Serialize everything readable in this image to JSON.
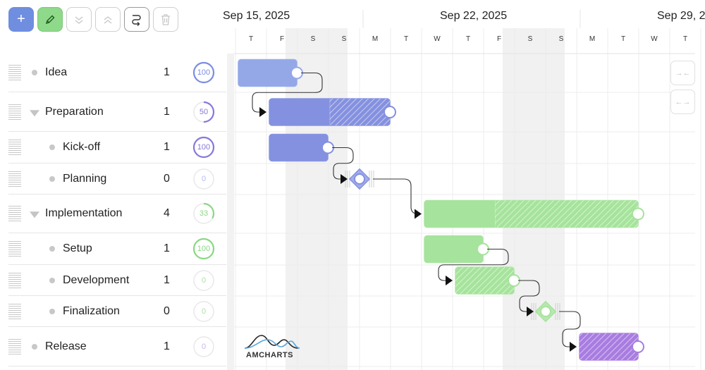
{
  "toolbar": {
    "buttons": [
      {
        "name": "add",
        "icon": "plus-icon",
        "label": "+"
      },
      {
        "name": "edit",
        "icon": "pencil-icon"
      },
      {
        "name": "expand-all",
        "icon": "chevrons-down-icon"
      },
      {
        "name": "collapse-all",
        "icon": "chevrons-up-icon"
      },
      {
        "name": "link",
        "icon": "link-arrow-icon"
      },
      {
        "name": "delete",
        "icon": "trash-icon"
      }
    ]
  },
  "colors": {
    "blue_bar": "#8491e0",
    "blue_light": "#94a8e8",
    "green_bar": "#a6e39c",
    "purple_bar": "#a87ce0",
    "weekend": "#f1f1f1",
    "progress_blue": "#7b8ee2",
    "progress_purple": "#8878d8",
    "progress_green": "#8ad884",
    "progress_lilac": "#c9b6ec"
  },
  "header": {
    "week_labels": [
      "Sep 15, 2025",
      "Sep 22, 2025",
      "Sep 29, 2"
    ],
    "day_labels": [
      "T",
      "F",
      "S",
      "S",
      "M",
      "T",
      "W",
      "T",
      "F",
      "S",
      "S",
      "M",
      "T",
      "W",
      "T"
    ]
  },
  "tasks": [
    {
      "name": "Idea",
      "count": "1",
      "progress": 100,
      "progress_label": "100",
      "level": 0,
      "group": false,
      "color": "#7b8ee2"
    },
    {
      "name": "Preparation",
      "count": "1",
      "progress": 50,
      "progress_label": "50",
      "level": 0,
      "group": true,
      "color": "#8878d8"
    },
    {
      "name": "Kick-off",
      "count": "1",
      "progress": 100,
      "progress_label": "100",
      "level": 1,
      "group": false,
      "color": "#8878d8"
    },
    {
      "name": "Planning",
      "count": "0",
      "progress": 0,
      "progress_label": "0",
      "level": 1,
      "group": false,
      "color": "#b7b7ee"
    },
    {
      "name": "Implementation",
      "count": "4",
      "progress": 33,
      "progress_label": "33",
      "level": 0,
      "group": true,
      "color": "#8ad884"
    },
    {
      "name": "Setup",
      "count": "1",
      "progress": 100,
      "progress_label": "100",
      "level": 1,
      "group": false,
      "color": "#8ad884"
    },
    {
      "name": "Development",
      "count": "1",
      "progress": 0,
      "progress_label": "0",
      "level": 1,
      "group": false,
      "color": "#a9e3a3"
    },
    {
      "name": "Finalization",
      "count": "0",
      "progress": 0,
      "progress_label": "0",
      "level": 1,
      "group": false,
      "color": "#a9e3a3"
    },
    {
      "name": "Release",
      "count": "1",
      "progress": 0,
      "progress_label": "0",
      "level": 0,
      "group": false,
      "color": "#c9b6ec"
    }
  ],
  "side_buttons": [
    {
      "name": "zoom-in-button",
      "icon": "arrows-in-icon",
      "label": "→←"
    },
    {
      "name": "zoom-out-button",
      "icon": "arrows-out-icon",
      "label": "←→"
    }
  ],
  "logo": {
    "text": "AMCHARTS"
  },
  "chart_data": {
    "type": "gantt",
    "start_date": "2025-09-16",
    "timeline_days": [
      "2025-09-16",
      "2025-09-17",
      "2025-09-18",
      "2025-09-19",
      "2025-09-20",
      "2025-09-21",
      "2025-09-22",
      "2025-09-23",
      "2025-09-24",
      "2025-09-25",
      "2025-09-26",
      "2025-09-27",
      "2025-09-28",
      "2025-09-29",
      "2025-09-30"
    ],
    "weekend_dates": [
      "2025-09-18",
      "2025-09-19",
      "2025-09-25",
      "2025-09-26"
    ],
    "tasks": [
      {
        "name": "Idea",
        "start": "2025-09-16",
        "end": "2025-09-17",
        "progress": 100,
        "color": "#94a8e8",
        "kind": "bar"
      },
      {
        "name": "Preparation",
        "start": "2025-09-17",
        "end": "2025-09-20",
        "progress": 50,
        "color": "#8491e0",
        "kind": "bar"
      },
      {
        "name": "Kick-off",
        "start": "2025-09-17",
        "end": "2025-09-18",
        "progress": 100,
        "color": "#8491e0",
        "kind": "bar"
      },
      {
        "name": "Planning",
        "start": "2025-09-20",
        "end": "2025-09-20",
        "progress": 0,
        "color": "#8491e0",
        "kind": "milestone"
      },
      {
        "name": "Implementation",
        "start": "2025-09-22",
        "end": "2025-09-28",
        "progress": 33,
        "color": "#a6e39c",
        "kind": "bar"
      },
      {
        "name": "Setup",
        "start": "2025-09-22",
        "end": "2025-09-23",
        "progress": 100,
        "color": "#a6e39c",
        "kind": "bar"
      },
      {
        "name": "Development",
        "start": "2025-09-23",
        "end": "2025-09-24",
        "progress": 0,
        "color": "#a6e39c",
        "kind": "bar"
      },
      {
        "name": "Finalization",
        "start": "2025-09-26",
        "end": "2025-09-26",
        "progress": 0,
        "color": "#a6e39c",
        "kind": "milestone"
      },
      {
        "name": "Release",
        "start": "2025-09-27",
        "end": "2025-09-28",
        "progress": 0,
        "color": "#a87ce0",
        "kind": "bar"
      }
    ],
    "links": [
      {
        "from": "Idea",
        "to": "Preparation"
      },
      {
        "from": "Kick-off",
        "to": "Planning"
      },
      {
        "from": "Planning",
        "to": "Implementation"
      },
      {
        "from": "Setup",
        "to": "Development"
      },
      {
        "from": "Development",
        "to": "Finalization"
      },
      {
        "from": "Finalization",
        "to": "Release"
      }
    ]
  }
}
